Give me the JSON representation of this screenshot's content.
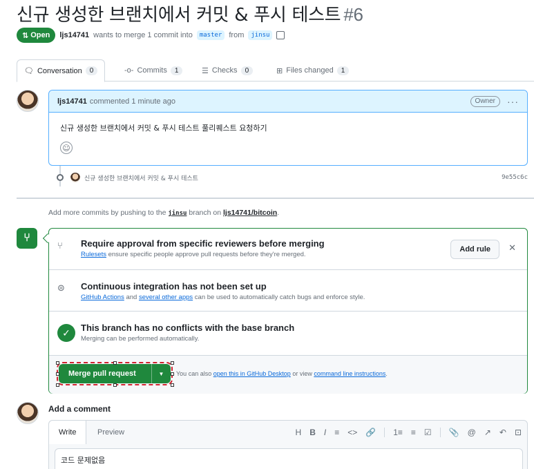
{
  "pr": {
    "title": "신규 생성한 브랜치에서 커밋 & 푸시 테스트",
    "number": "#6",
    "state": "Open",
    "author": "ljs14741",
    "merge_text_1": "wants to merge 1 commit into",
    "base_branch": "master",
    "merge_text_2": "from",
    "head_branch": "jinsu"
  },
  "tabs": [
    {
      "label": "Conversation",
      "count": "0",
      "icon": "comment-icon"
    },
    {
      "label": "Commits",
      "count": "1",
      "icon": "commit-icon"
    },
    {
      "label": "Checks",
      "count": "0",
      "icon": "checklist-icon"
    },
    {
      "label": "Files changed",
      "count": "1",
      "icon": "file-diff-icon"
    }
  ],
  "comment": {
    "author": "ljs14741",
    "time": "commented 1 minute ago",
    "badge": "Owner",
    "body": "신규 생성한 브랜치에서 커밋 & 푸시 테스트 풀리퀘스트 요청하기"
  },
  "commit": {
    "message": "신규 생성한 브랜치에서 커밋 & 푸시 테스트",
    "sha": "9e55c6c"
  },
  "push_hint": {
    "prefix": "Add more commits by pushing to the",
    "branch": "jinsu",
    "middle": "branch on",
    "repo": "ljs14741/bitcoin",
    "suffix": "."
  },
  "merge_box": {
    "rulesets": {
      "heading": "Require approval from specific reviewers before merging",
      "link": "Rulesets",
      "text": "ensure specific people approve pull requests before they're merged.",
      "button": "Add rule"
    },
    "ci": {
      "heading": "Continuous integration has not been set up",
      "link1": "GitHub Actions",
      "and": "and",
      "link2": "several other apps",
      "text": "can be used to automatically catch bugs and enforce style."
    },
    "conflicts": {
      "heading": "This branch has no conflicts with the base branch",
      "text": "Merging can be performed automatically."
    },
    "merge_button": "Merge pull request",
    "footer_prefix": "You can also",
    "footer_link1": "open this in GitHub Desktop",
    "footer_mid": "or view",
    "footer_link2": "command line instructions",
    "footer_suffix": "."
  },
  "add_comment": {
    "title": "Add a comment",
    "tab_write": "Write",
    "tab_preview": "Preview",
    "value": "코드 문제없음",
    "toolbar": [
      "H",
      "B",
      "I",
      "≡",
      "<>",
      "🔗",
      "1≡",
      "≡",
      "☑",
      "📎",
      "@",
      "↗",
      "↶",
      "⊡"
    ]
  }
}
